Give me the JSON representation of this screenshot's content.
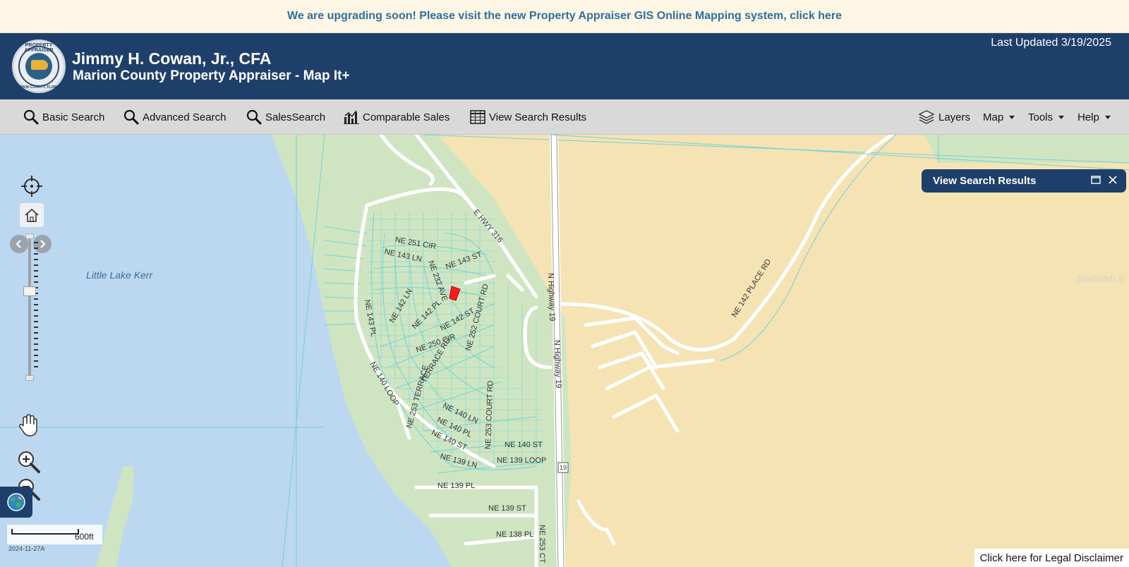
{
  "banner": {
    "text": "We are upgrading soon! Please visit the new Property Appraiser GIS Online Mapping system, click here"
  },
  "header": {
    "seal_top": "PROPERTY APPRAISER",
    "seal_bottom": "MARION COUNTY, FLORIDA",
    "name": "Jimmy H. Cowan, Jr., CFA",
    "subtitle": "Marion County Property Appraiser - Map It+",
    "last_updated": "Last Updated 3/19/2025"
  },
  "toolbar": {
    "basic_search": "Basic Search",
    "advanced_search": "Advanced Search",
    "sales_search": "SalesSearch",
    "comparable_sales": "Comparable Sales",
    "view_search_results": "View Search Results",
    "layers": "Layers",
    "map": "Map",
    "tools": "Tools",
    "help": "Help"
  },
  "map": {
    "lake_label": "Little Lake Kerr",
    "watermark": "StellarMLS",
    "road_labels": {
      "e_hwy_316": "E HWY 316",
      "ne_251_cir": "NE 251 CIR",
      "ne_143_ln": "NE 143 LN",
      "ne_143_st": "NE 143 ST",
      "ne_232_ave": "NE 232 AVE",
      "ne_143_pl": "NE 143 PL",
      "ne_142_ln": "NE 142 LN",
      "ne_142_pl": "NE 142 PL",
      "ne_142_st": "NE 142 ST",
      "ne_252_court_rd": "NE 252 COURT RD",
      "ne_250_cir": "NE 250 CIR",
      "terrace_rd": "TERRACE RD",
      "ne_140_loop": "NE 140 LOOP",
      "ne_253_terrace": "NE 253 TERRACE",
      "ne_140_ln": "NE 140 LN",
      "ne_140_pl": "NE 140 PL",
      "ne_140_st_a": "NE 140 ST",
      "ne_253_court_rd": "NE 253 COURT RD",
      "ne_140_st_b": "NE 140 ST",
      "ne_139_ln": "NE 139 LN",
      "ne_139_loop": "NE 139 LOOP",
      "ne_139_pl": "NE 139 PL",
      "ne_139_st": "NE 139 ST",
      "ne_253_ct": "NE 253 CT",
      "ne_138_pl": "NE 138 PL",
      "n_highway_19": "N Highway 19",
      "n_highway_19_b": "N Highway 19",
      "hwy_shield": "19",
      "ne_142_place_rd": "NE 142 PLACE RD"
    },
    "scale_label": "600ft",
    "map_date": "2024-11-27A",
    "colors": {
      "water": "#bcd7f0",
      "land": "#f5e3b4",
      "subdivision": "#cfe5c2",
      "parcel_line": "#6fd3d3"
    }
  },
  "results_panel": {
    "title": "View Search Results"
  },
  "disclaimer": "Click here for Legal Disclaimer"
}
